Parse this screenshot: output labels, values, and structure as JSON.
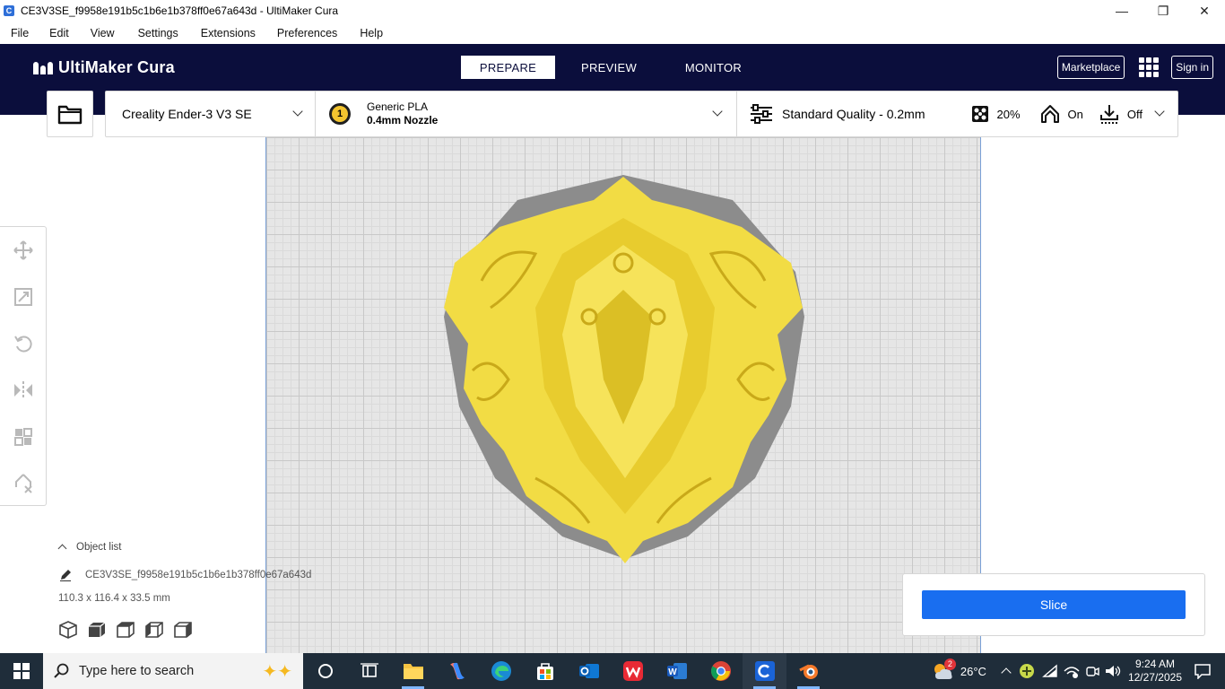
{
  "window": {
    "title": "CE3V3SE_f9958e191b5c1b6e1b378ff0e67a643d - UltiMaker Cura",
    "controls": [
      "minimize",
      "restore",
      "close"
    ]
  },
  "menu": [
    "File",
    "Edit",
    "View",
    "Settings",
    "Extensions",
    "Preferences",
    "Help"
  ],
  "header": {
    "logo_text": "UltiMaker Cura",
    "stages": [
      {
        "label": "PREPARE",
        "active": true
      },
      {
        "label": "PREVIEW",
        "active": false
      },
      {
        "label": "MONITOR",
        "active": false
      }
    ],
    "marketplace": "Marketplace",
    "sign_in": "Sign in"
  },
  "printer": {
    "name": "Creality Ender-3 V3 SE",
    "extruder_number": "1",
    "material": "Generic PLA",
    "nozzle": "0.4mm Nozzle",
    "quality": "Standard Quality - 0.2mm",
    "infill": "20%",
    "support": "On",
    "adhesion": "Off"
  },
  "object_list": {
    "header": "Object list",
    "object_name": "CE3V3SE_f9958e191b5c1b6e1b378ff0e67a643d",
    "dimensions": "110.3 x 116.4 x 33.5 mm"
  },
  "slice": {
    "label": "Slice"
  },
  "taskbar": {
    "search_placeholder": "Type here to search",
    "weather_temp": "26°C",
    "weather_badge": "2",
    "time": "9:24 AM",
    "date": "12/27/2025"
  },
  "colors": {
    "header_bg": "#0b0e3c",
    "slice_button": "#196ef0",
    "model_yellow": "#f3df4a",
    "support_gray": "#8c8c8c"
  }
}
